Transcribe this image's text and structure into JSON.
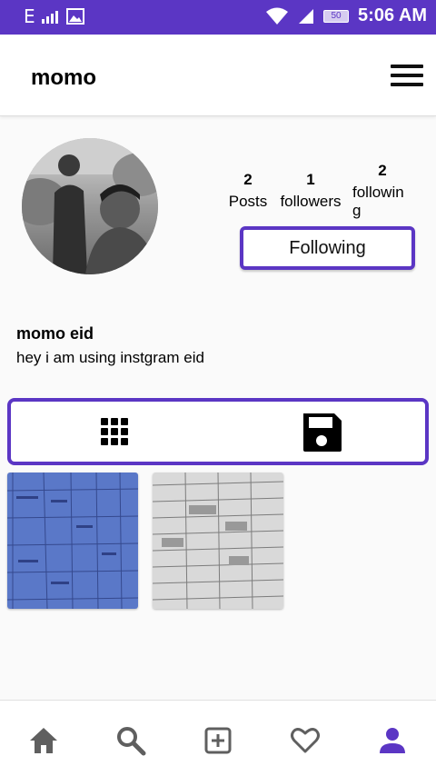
{
  "status_bar": {
    "carrier": "E",
    "signal_icon": "signal-icon",
    "image_icon": "image-icon",
    "wifi_icon": "wifi-icon",
    "battery_level": "50",
    "time": "5:06 AM"
  },
  "app_bar": {
    "title": "momo",
    "menu_icon": "hamburger-menu-icon"
  },
  "profile": {
    "avatar": "profile-photo",
    "stats": {
      "posts_count": "2",
      "posts_label": "Posts",
      "followers_count": "1",
      "followers_label": "followers",
      "following_count": "2",
      "following_label": "followin g"
    },
    "follow_button_label": "Following",
    "name": "momo eid",
    "bio": "hey i am using instgram eid"
  },
  "tabs": [
    {
      "name": "grid",
      "icon": "grid-icon"
    },
    {
      "name": "saved",
      "icon": "save-icon"
    }
  ],
  "posts": [
    {
      "name": "post-1",
      "tone": "#5a78c8"
    },
    {
      "name": "post-2",
      "tone": "#d9d9d9"
    }
  ],
  "bottom_nav": [
    {
      "name": "home",
      "icon": "home-icon"
    },
    {
      "name": "search",
      "icon": "search-icon"
    },
    {
      "name": "add",
      "icon": "add-box-icon"
    },
    {
      "name": "activity",
      "icon": "heart-icon"
    },
    {
      "name": "profile",
      "icon": "person-icon",
      "active": true
    }
  ],
  "colors": {
    "accent": "#5b36c4",
    "icon_inactive": "#5f5f5f"
  }
}
